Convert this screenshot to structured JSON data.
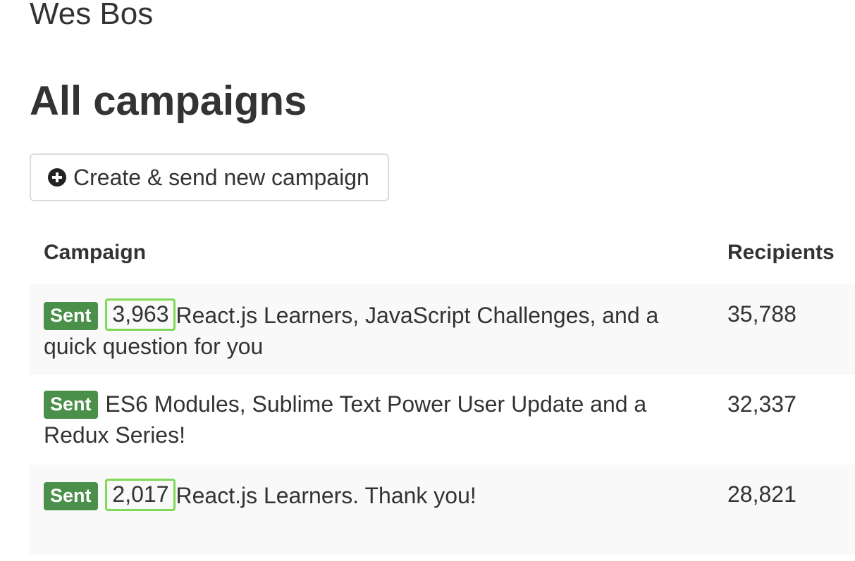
{
  "header": {
    "brand": "Wes Bos",
    "page_title": "All campaigns"
  },
  "toolbar": {
    "create_label": "Create & send new campaign",
    "create_icon": "plus-circle-icon"
  },
  "table": {
    "columns": {
      "campaign": "Campaign",
      "recipients": "Recipients"
    },
    "rows": [
      {
        "status": "Sent",
        "opens": "3,963",
        "subject": "React.js Learners, JavaScript Challenges, and a quick question for you",
        "recipients": "35,788"
      },
      {
        "status": "Sent",
        "opens": "",
        "subject": "ES6 Modules, Sublime Text Power User Update and a Redux Series!",
        "recipients": "32,337"
      },
      {
        "status": "Sent",
        "opens": "2,017",
        "subject": "React.js Learners. Thank you!",
        "recipients": "28,821"
      }
    ]
  },
  "colors": {
    "sent_badge": "#4a8f4a",
    "highlight": "#7ed957",
    "row_stripe": "#f9f9f9",
    "text": "#333333"
  }
}
